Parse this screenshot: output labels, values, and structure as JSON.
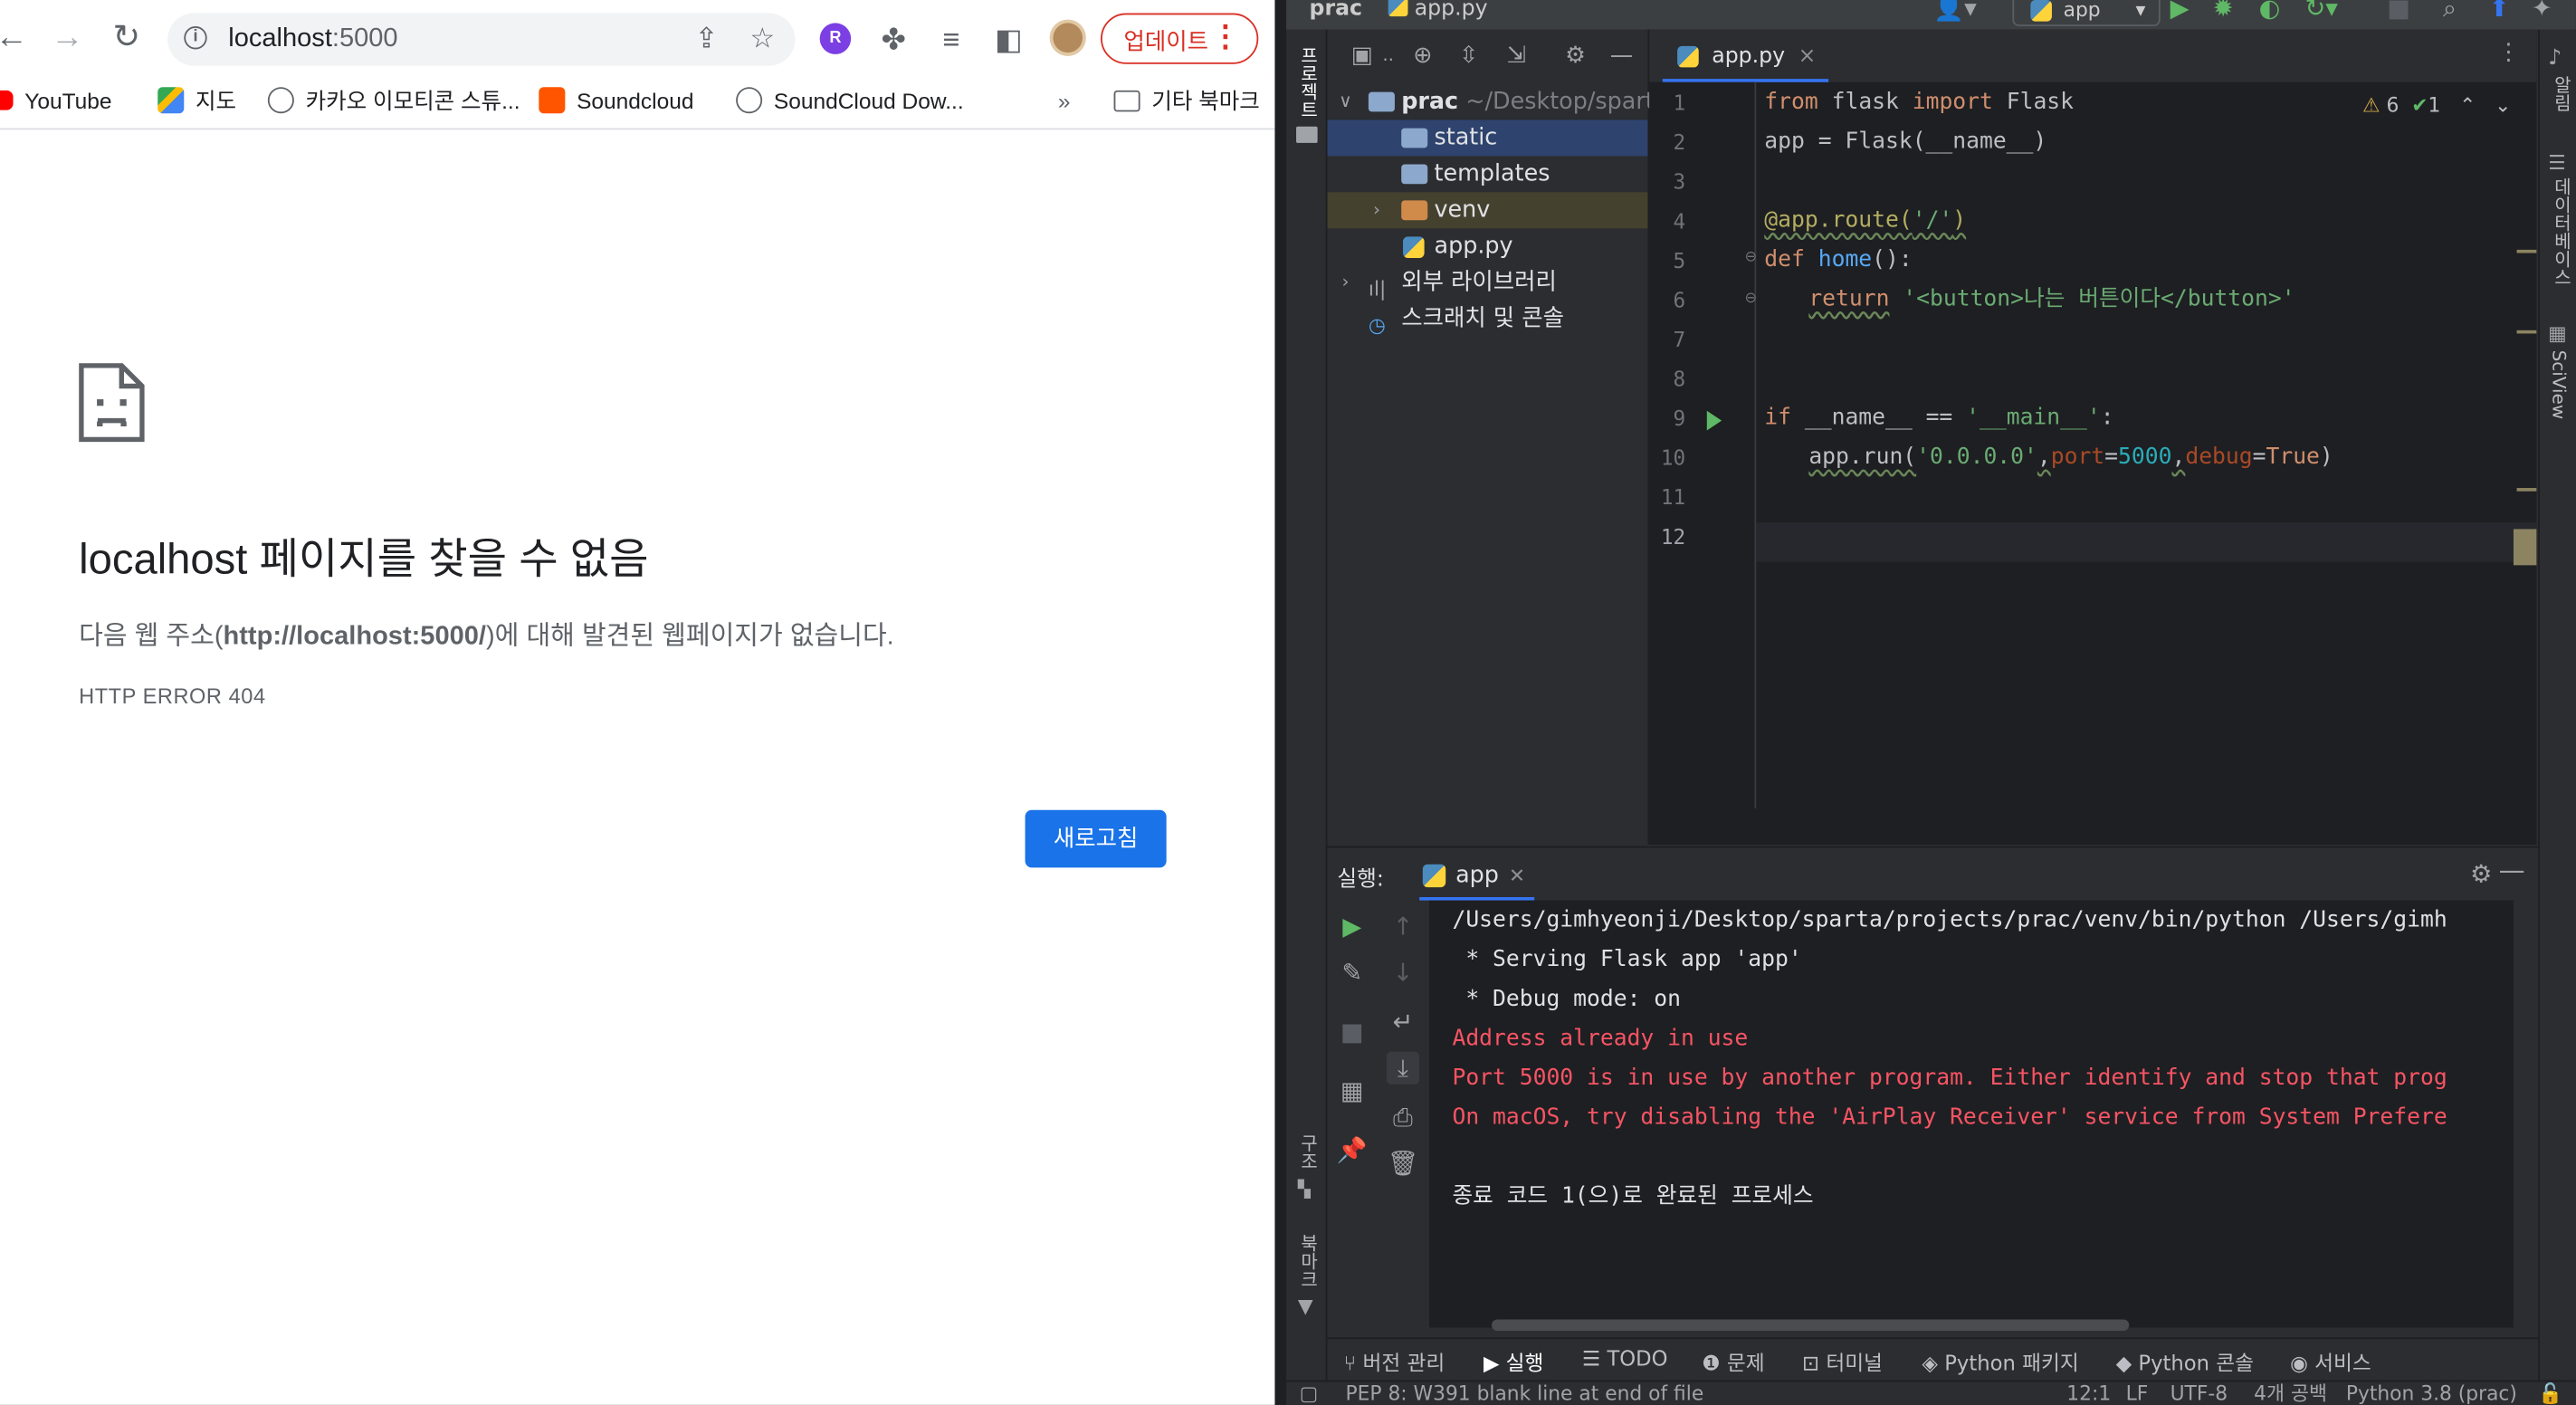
{
  "browser": {
    "url_host": "localhost",
    "url_port": ":5000",
    "update_label": "업데이트",
    "bookmarks": [
      {
        "label": "YouTube"
      },
      {
        "label": "지도"
      },
      {
        "label": "카카오 이모티콘 스튜..."
      },
      {
        "label": "Soundcloud"
      },
      {
        "label": "SoundCloud Dow..."
      }
    ],
    "overflow_label": "»",
    "other_bookmarks": "기타 북마크",
    "error": {
      "title": "localhost 페이지를 찾을 수 없음",
      "desc_prefix": "다음 웹 주소(",
      "desc_url": "http://localhost:5000/",
      "desc_suffix": ")에 대해 발견된 웹페이지가 없습니다.",
      "code": "HTTP ERROR 404",
      "reload_label": "새로고침"
    }
  },
  "ide": {
    "title_project": "prac",
    "title_file": "app.py",
    "run_config": "app",
    "left_stripe_project": "프로젝트",
    "left_stripe_structure": "구조",
    "left_stripe_bookmarks": "북마크",
    "right_stripe_notifications": "알림",
    "right_stripe_database": "데이터베이스",
    "right_stripe_sciview": "SciView",
    "tree": {
      "root_name": "prac",
      "root_path": " ~/Desktop/sparta",
      "static": "static",
      "templates": "templates",
      "venv": "venv",
      "app": "app.py",
      "external": "외부 라이브러리",
      "scratches": "스크래치 및 콘솔"
    },
    "editor_tab": "app.py",
    "inspections": {
      "warnings": "6",
      "ok": "1"
    },
    "line_numbers": [
      "1",
      "2",
      "3",
      "4",
      "5",
      "6",
      "7",
      "8",
      "9",
      "10",
      "11",
      "12"
    ],
    "code": {
      "l1_from": "from",
      "l1_mod": " flask ",
      "l1_import": "import",
      "l1_name": " Flask",
      "l2": "app = Flask(__name__)",
      "l4_dec": "@app.route(",
      "l4_str": "'/'",
      "l4_close": ")",
      "l5_def": "def",
      "l5_fn": " home",
      "l5_rest": "():",
      "l6_ret": "return",
      "l6_str": " '<button>나는 버튼이다</button>'",
      "l9_if": "if",
      "l9_mid": " __name__ == ",
      "l9_str": "'__main__'",
      "l9_colon": ":",
      "l10_a": "app.run(",
      "l10_host": "'0.0.0.0'",
      "l10_comma1": ",",
      "l10_port_kw": "port",
      "l10_eq1": "=",
      "l10_port": "5000",
      "l10_comma2": ",",
      "l10_debug_kw": "debug",
      "l10_eq2": "=",
      "l10_true": "True",
      "l10_close": ")"
    },
    "run": {
      "label": "실행:",
      "tab": "app",
      "lines": [
        "/Users/gimhyeonji/Desktop/sparta/projects/prac/venv/bin/python /Users/gimh",
        " * Serving Flask app 'app'",
        " * Debug mode: on"
      ],
      "errors": [
        "Address already in use",
        "Port 5000 is in use by another program. Either identify and stop that prog",
        "On macOS, try disabling the 'AirPlay Receiver' service from System Prefere"
      ],
      "exit": "종료 코드 1(으)로 완료된 프로세스"
    },
    "bottom_tabs": {
      "vcs": "버전 관리",
      "run": "실행",
      "todo": "TODO",
      "problems": "문제",
      "terminal": "터미널",
      "packages": "Python 패키지",
      "console": "Python 콘솔",
      "services": "서비스"
    },
    "status": {
      "message": "PEP 8: W391 blank line at end of file",
      "position": "12:1",
      "line_sep": "LF",
      "encoding": "UTF-8",
      "indent": "4개 공백",
      "interpreter": "Python 3.8 (prac)"
    }
  }
}
